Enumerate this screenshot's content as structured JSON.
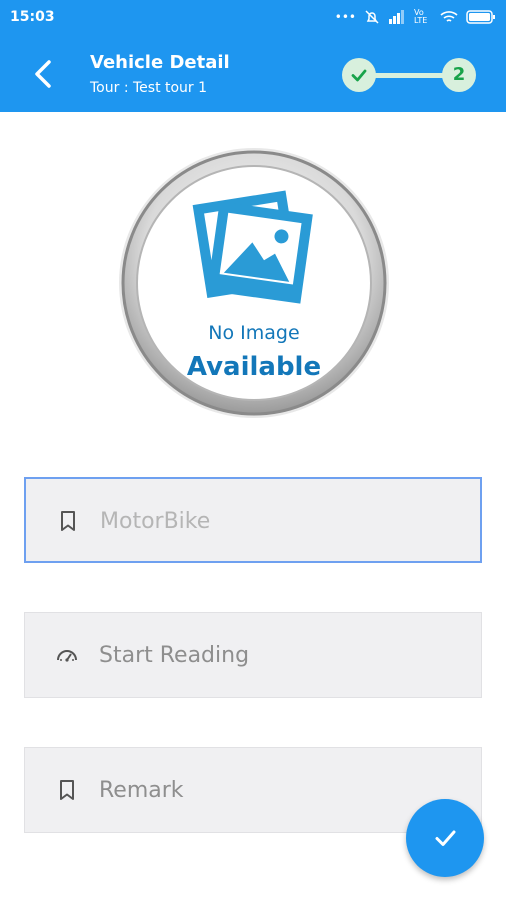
{
  "status_bar": {
    "time": "15:03",
    "indicators": [
      "more-dots-icon",
      "mute-icon",
      "signal-icon",
      "volte-icon",
      "wifi-icon",
      "battery-icon"
    ],
    "volte_label": "Vo LTE"
  },
  "header": {
    "title": "Vehicle Detail",
    "subtitle": "Tour : Test tour 1",
    "back_icon": "chevron-left-icon",
    "steps": [
      {
        "state": "done",
        "icon": "check-icon",
        "label": ""
      },
      {
        "state": "current",
        "label": "2"
      }
    ]
  },
  "vehicle_image": {
    "line1": "No Image",
    "line2": "Available",
    "icon": "photos-icon"
  },
  "form": {
    "vehicle_type": {
      "placeholder": "MotorBike",
      "icon": "bookmark-icon",
      "focused": true
    },
    "start_reading": {
      "placeholder": "Start Reading",
      "icon": "speedometer-icon"
    },
    "remark": {
      "placeholder": "Remark",
      "icon": "bookmark-icon"
    }
  },
  "fab": {
    "icon": "check-icon"
  },
  "colors": {
    "primary": "#1e96f0",
    "step_bg": "#d8f0dd",
    "step_fg": "#18a34a",
    "field_bg": "#f0f0f2"
  }
}
